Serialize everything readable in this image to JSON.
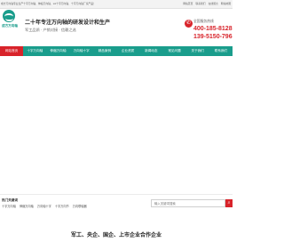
{
  "topbar": {
    "description": "成方万向轴专业生产十字万向轴、伸缩万向轴、ssl十字万向轴、十字万向轴厂家产品！",
    "links": [
      "网站首页",
      "联系我们",
      "在线留言",
      "网站地图"
    ]
  },
  "header": {
    "logo_text": "成方万向轴",
    "slogan_title": "二十年专注万向轴的研发设计和生产",
    "slogan_sub": "军工品质 · 产销对接 · 信赖之选",
    "phone_label": "全国服务热线",
    "phone_1": "400-185-8128",
    "phone_2": "139-5150-7961",
    "phone_icon": "phone-icon"
  },
  "nav": {
    "items": [
      {
        "label": "网站首页",
        "active": true
      },
      {
        "label": "十字万向轴",
        "active": false
      },
      {
        "label": "伸缩万向轴",
        "active": false
      },
      {
        "label": "万向轴十字",
        "active": false
      },
      {
        "label": "精品案例",
        "active": false
      },
      {
        "label": "企业资质",
        "active": false
      },
      {
        "label": "新闻动态",
        "active": false
      },
      {
        "label": "常见问题",
        "active": false
      },
      {
        "label": "关于我们",
        "active": false
      },
      {
        "label": "联系我们",
        "active": false
      }
    ]
  },
  "hot": {
    "label": "热门关键词",
    "items": [
      "十字万向轴",
      "伸缩万向轴",
      "万向轴十字",
      "十字万向节",
      "万向联轴器"
    ]
  },
  "search": {
    "placeholder": "输入关键词搜索",
    "button_icon": "search-icon"
  },
  "section": {
    "title": "军工、央企、国企、上市企业合作企业"
  },
  "colors": {
    "brand_green": "#1a9d8c",
    "accent_red": "#d8232a"
  }
}
